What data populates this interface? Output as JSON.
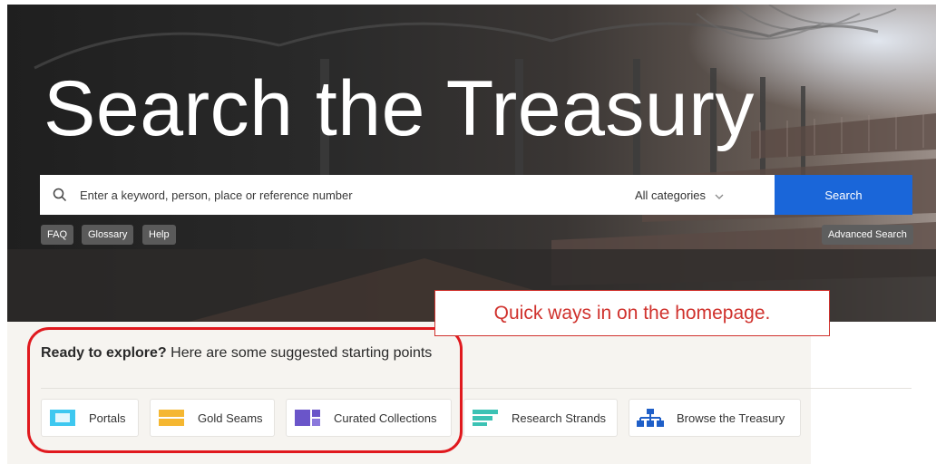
{
  "hero": {
    "title": "Search the Treasury"
  },
  "search": {
    "placeholder": "Enter a keyword, person, place or reference number",
    "category": "All categories",
    "button_label": "Search"
  },
  "quick_links": {
    "faq": "FAQ",
    "glossary": "Glossary",
    "help": "Help",
    "advanced": "Advanced Search"
  },
  "explore": {
    "lead": "Ready to explore?",
    "text": " Here are some suggested starting points"
  },
  "cards": [
    {
      "label": "Portals",
      "icon": "portal-icon",
      "color": "#3ec8f0"
    },
    {
      "label": "Gold Seams",
      "icon": "gold-seams-icon",
      "color": "#f5b731"
    },
    {
      "label": "Curated Collections",
      "icon": "curated-collections-icon",
      "color": "#6a55c9"
    },
    {
      "label": "Research Strands",
      "icon": "research-strands-icon",
      "color": "#3cc2b4"
    },
    {
      "label": "Browse the Treasury",
      "icon": "sitemap-icon",
      "color": "#1f5fc8"
    }
  ],
  "annotation": {
    "callout": "Quick ways in on the homepage."
  },
  "colors": {
    "accent": "#1a66d9",
    "annotation_red": "#d0322d"
  }
}
